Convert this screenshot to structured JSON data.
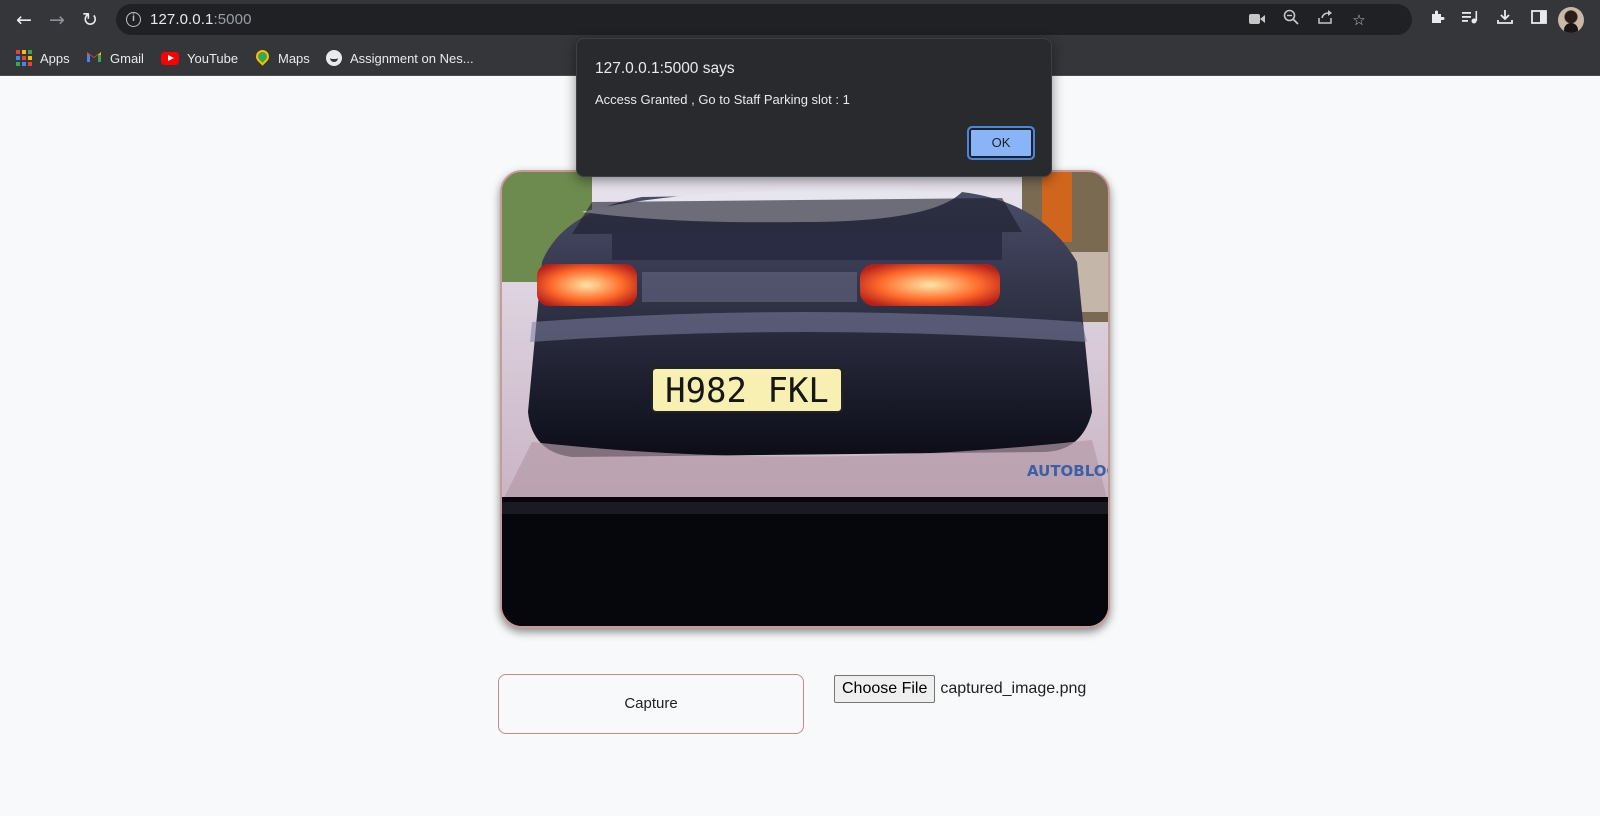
{
  "browser": {
    "url_host": "127.0.0.1",
    "url_port": ":5000",
    "info_icon_glyph": "i",
    "bookmarks": [
      {
        "label": "Apps",
        "icon": "apps-grid-icon"
      },
      {
        "label": "Gmail",
        "icon": "gmail-icon"
      },
      {
        "label": "YouTube",
        "icon": "youtube-icon"
      },
      {
        "label": "Maps",
        "icon": "maps-icon"
      },
      {
        "label": "Assignment on Nes...",
        "icon": "site-icon"
      }
    ]
  },
  "camera": {
    "plate_text": "H982 FKL",
    "watermark": "AUTOBLOG"
  },
  "controls": {
    "capture_label": "Capture",
    "choose_file_label": "Choose File",
    "file_name": "captured_image.png"
  },
  "alert": {
    "title": "127.0.0.1:5000 says",
    "message": "Access Granted , Go to Staff Parking slot : 1",
    "ok_label": "OK"
  },
  "colors": {
    "chrome_bg": "#35363a",
    "omnibox_bg": "#202124",
    "page_bg": "#f8f9fa",
    "dialog_bg": "#292a2d",
    "ok_button": "#8ab4f8",
    "capture_border": "#c98a86"
  }
}
